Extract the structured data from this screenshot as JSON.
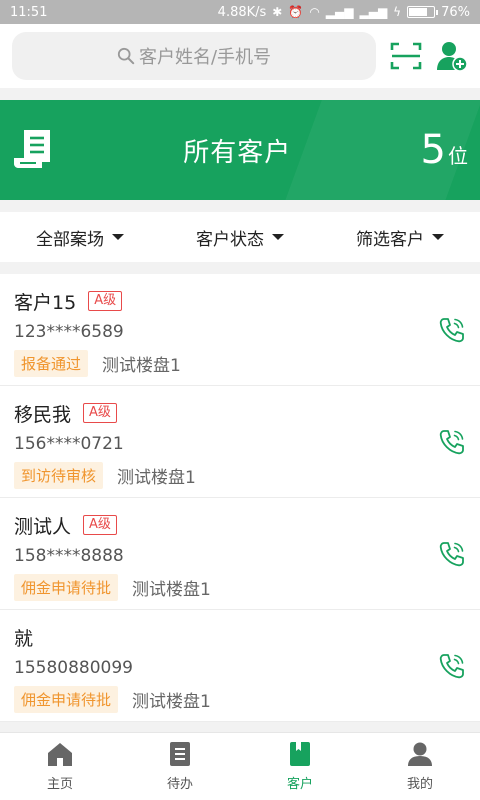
{
  "status_bar": {
    "time": "11:51",
    "network_speed": "4.88K/s",
    "battery_percent": "76%",
    "battery_level": 0.76
  },
  "search": {
    "placeholder": "客户姓名/手机号"
  },
  "header_icons": [
    "scan-icon",
    "add-user-icon"
  ],
  "banner": {
    "title": "所有客户",
    "count": "5",
    "count_unit": "位"
  },
  "filters": [
    {
      "label": "全部案场"
    },
    {
      "label": "客户状态"
    },
    {
      "label": "筛选客户"
    }
  ],
  "customers": [
    {
      "name": "客户15",
      "grade": "A级",
      "phone": "123****6589",
      "status": "报备通过",
      "project": "测试楼盘1"
    },
    {
      "name": "移民我",
      "grade": "A级",
      "phone": "156****0721",
      "status": "到访待审核",
      "project": "测试楼盘1"
    },
    {
      "name": "测试人",
      "grade": "A级",
      "phone": "158****8888",
      "status": "佣金申请待批",
      "project": "测试楼盘1"
    },
    {
      "name": "就",
      "grade": "",
      "phone": "15580880099",
      "status": "佣金申请待批",
      "project": "测试楼盘1"
    }
  ],
  "bottom_nav": [
    {
      "label": "主页",
      "icon": "home-icon",
      "active": false
    },
    {
      "label": "待办",
      "icon": "todo-icon",
      "active": false
    },
    {
      "label": "客户",
      "icon": "customer-book-icon",
      "active": true
    },
    {
      "label": "我的",
      "icon": "profile-icon",
      "active": false
    }
  ],
  "colors": {
    "brand_green": "#17a25e",
    "grade_red": "#e84a4a",
    "tag_orange": "#f0952e",
    "tag_bg": "#fdf1e0"
  }
}
